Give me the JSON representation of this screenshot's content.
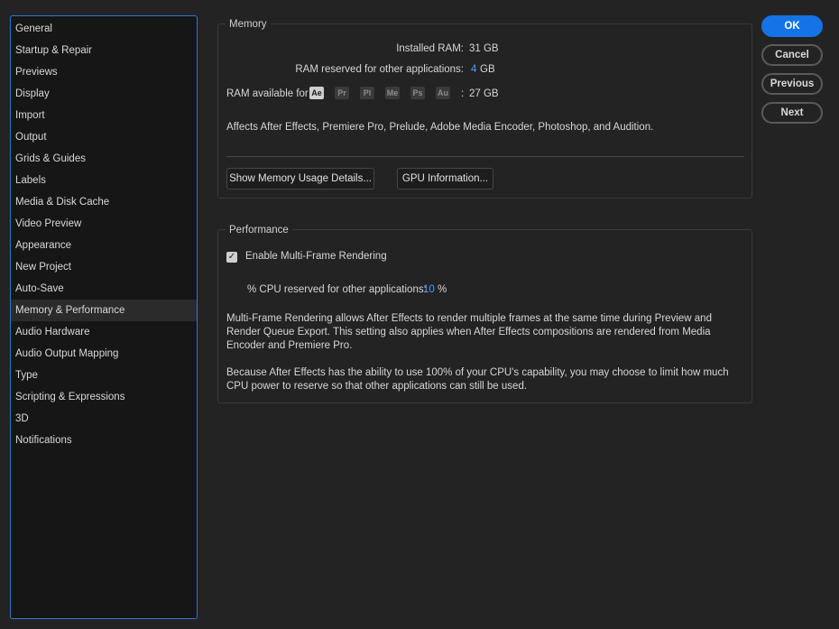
{
  "sidebar": {
    "items": [
      {
        "label": "General"
      },
      {
        "label": "Startup & Repair"
      },
      {
        "label": "Previews"
      },
      {
        "label": "Display"
      },
      {
        "label": "Import"
      },
      {
        "label": "Output"
      },
      {
        "label": "Grids & Guides"
      },
      {
        "label": "Labels"
      },
      {
        "label": "Media & Disk Cache"
      },
      {
        "label": "Video Preview"
      },
      {
        "label": "Appearance"
      },
      {
        "label": "New Project"
      },
      {
        "label": "Auto-Save"
      },
      {
        "label": "Memory & Performance",
        "selected": true
      },
      {
        "label": "Audio Hardware"
      },
      {
        "label": "Audio Output Mapping"
      },
      {
        "label": "Type"
      },
      {
        "label": "Scripting & Expressions"
      },
      {
        "label": "3D"
      },
      {
        "label": "Notifications"
      }
    ]
  },
  "memory": {
    "title": "Memory",
    "installed_label": "Installed RAM:",
    "installed_value": "31 GB",
    "reserved_label": "RAM reserved for other applications:",
    "reserved_value": "4",
    "reserved_unit": "GB",
    "available_label": "RAM available for",
    "apps": [
      {
        "abbr": "Ae",
        "active": true
      },
      {
        "abbr": "Pr",
        "active": false
      },
      {
        "abbr": "Pl",
        "active": false
      },
      {
        "abbr": "Me",
        "active": false
      },
      {
        "abbr": "Ps",
        "active": false
      },
      {
        "abbr": "Au",
        "active": false
      }
    ],
    "available_sep": ":",
    "available_value": "27 GB",
    "affects_text": "Affects After Effects, Premiere Pro, Prelude, Adobe Media Encoder, Photoshop, and Audition.",
    "details_button": "Show Memory Usage Details...",
    "gpu_button": "GPU Information..."
  },
  "performance": {
    "title": "Performance",
    "mfr_checked": true,
    "mfr_check_glyph": "✓",
    "mfr_label": "Enable Multi-Frame Rendering",
    "cpu_label": "% CPU reserved for other applications:",
    "cpu_value": "10",
    "cpu_unit": "%",
    "desc1": "Multi-Frame Rendering allows After Effects to render multiple frames at the same time during Preview and Render Queue Export. This setting also applies when After Effects compositions are rendered from Media Encoder and Premiere Pro.",
    "desc2": "Because After Effects has the ability to use 100% of your CPU's capability, you may choose to limit how much CPU power to reserve so that other applications can still be used."
  },
  "dialog_buttons": {
    "ok": "OK",
    "cancel": "Cancel",
    "previous": "Previous",
    "next": "Next"
  },
  "colors": {
    "accent": "#1473e6",
    "value_blue": "#4f9bff",
    "sidebar_border": "#2f74d0"
  }
}
